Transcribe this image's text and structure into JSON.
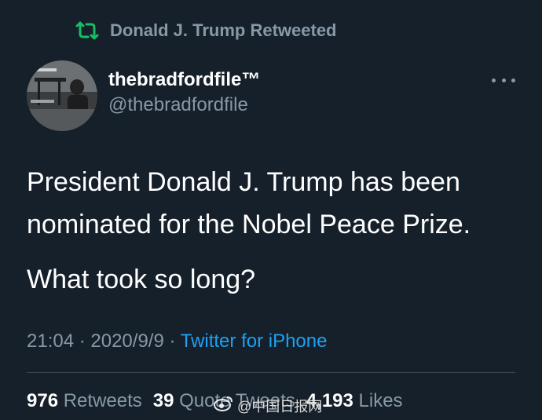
{
  "retweet_context": {
    "icon": "retweet-icon",
    "text": "Donald J. Trump Retweeted",
    "icon_color": "#17bf63"
  },
  "author": {
    "display_name": "thebradfordfile™",
    "handle": "@thebradfordfile"
  },
  "more_icon": "more-dots-icon",
  "tweet": {
    "paragraph_1": "President Donald J. Trump has been nominated for the Nobel Peace Prize.",
    "paragraph_2": "What took so long?"
  },
  "meta": {
    "time": "21:04",
    "separator_1": " · ",
    "date": "2020/9/9",
    "separator_2": " · ",
    "source": "Twitter for iPhone"
  },
  "stats": {
    "retweets_count": "976",
    "retweets_label": "Retweets",
    "quotes_count": "39",
    "quotes_label": "Quote Tweets",
    "likes_count": "4,193",
    "likes_label": "Likes"
  },
  "watermark": {
    "icon": "weibo-icon",
    "text": "@中国日报网"
  },
  "colors": {
    "background": "#15202b",
    "primary_text": "#ffffff",
    "secondary_text": "#8899a6",
    "link": "#1da1f2",
    "divider": "#38444d"
  }
}
